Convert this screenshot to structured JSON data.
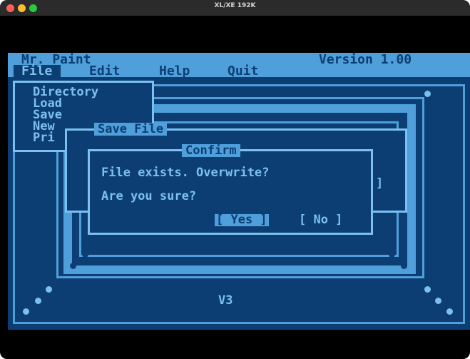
{
  "window": {
    "title": "XL/XE 192K"
  },
  "header": {
    "app_name": "Mr. Paint",
    "version": "Version 1.00"
  },
  "menubar": {
    "file": "File",
    "edit": "Edit",
    "help": "Help",
    "quit": "Quit"
  },
  "file_menu": {
    "items": [
      "Directory",
      "Load",
      "Save",
      "New",
      "Pri"
    ]
  },
  "save_dialog": {
    "title": "Save File",
    "bracket_right": "]"
  },
  "confirm_dialog": {
    "title": "Confirm",
    "message": "File exists. Overwrite?",
    "question": "Are you sure?",
    "yes_label": "[ Yes ]",
    "no_label": "[ No ]"
  },
  "canvas": {
    "version_tag": "V3"
  },
  "colors": {
    "dark": "#0c3e74",
    "light": "#4f9fdb",
    "text_light": "#7cc0f0"
  }
}
